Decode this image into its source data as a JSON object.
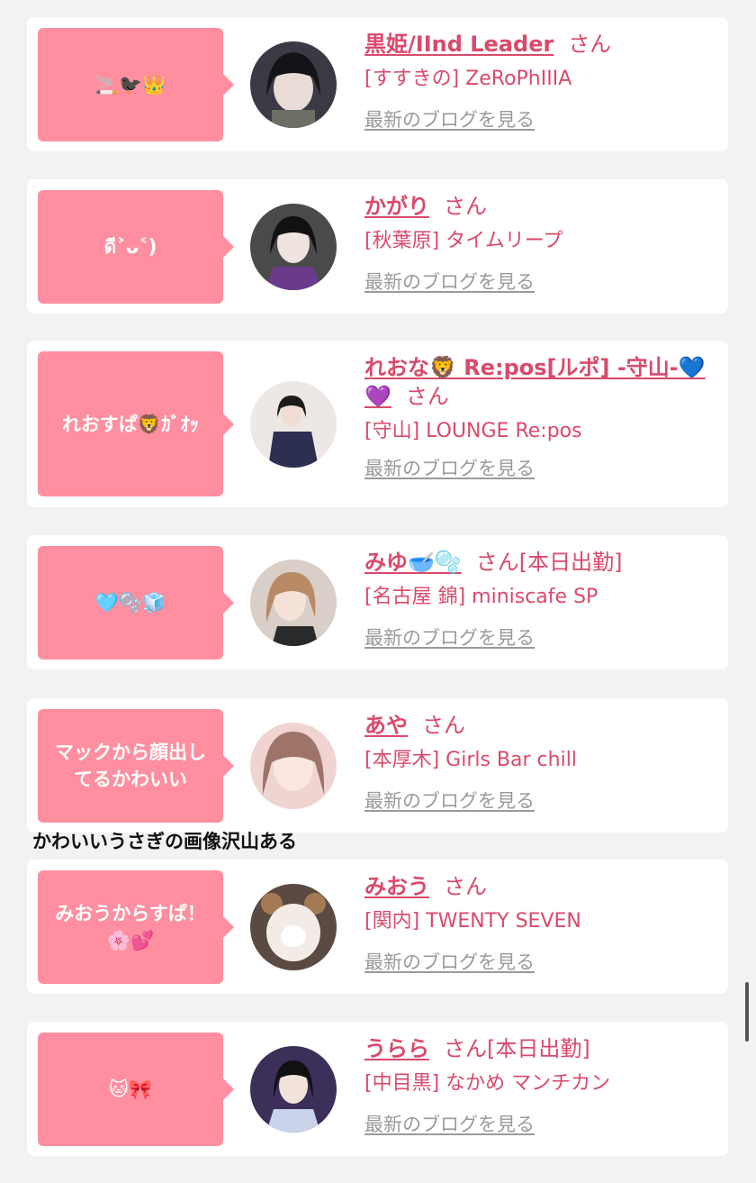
{
  "suffix": "さん",
  "blog_label": "最新のブログを見る",
  "caption": "かわいいうさぎの画像沢山ある",
  "colors": {
    "bubble": "#ff8fa0",
    "accent": "#d94a6b",
    "link_gray": "#9a9a9a",
    "background": "#f2f2f2"
  },
  "entries": [
    {
      "bubble": "🚬🐦‍⬛👑",
      "name": "黒姫/IInd Leader",
      "status": "",
      "shop": "[すすきの] ZeRoPhIIIA"
    },
    {
      "bubble": "ดี˃ᴗ˂)",
      "name": "かがり",
      "status": "",
      "shop": "[秋葉原] タイムリープ"
    },
    {
      "bubble": "れおすぱ🦁ｶﾞｵｯ",
      "name": "れおな🦁 Re:pos[ルポ] -守山-💙💜",
      "status": "",
      "shop": "[守山] LOUNGE Re:pos"
    },
    {
      "bubble": "🩵🫧🧊",
      "name": "みゆ🥣🫧",
      "status": "[本日出勤]",
      "shop": "[名古屋 錦] miniscafe SP"
    },
    {
      "bubble": "マックから顔出してるかわいい",
      "name": "あや",
      "status": "",
      "shop": "[本厚木] Girls Bar chill"
    },
    {
      "bubble": "みおうからすぱ！🌸💕",
      "name": "みおう",
      "status": "",
      "shop": "[関内] TWENTY SEVEN"
    },
    {
      "bubble": "🐱🎀",
      "name": "うらら",
      "status": "[本日出勤]",
      "shop": "[中目黒] なかめ マンチカン"
    }
  ]
}
